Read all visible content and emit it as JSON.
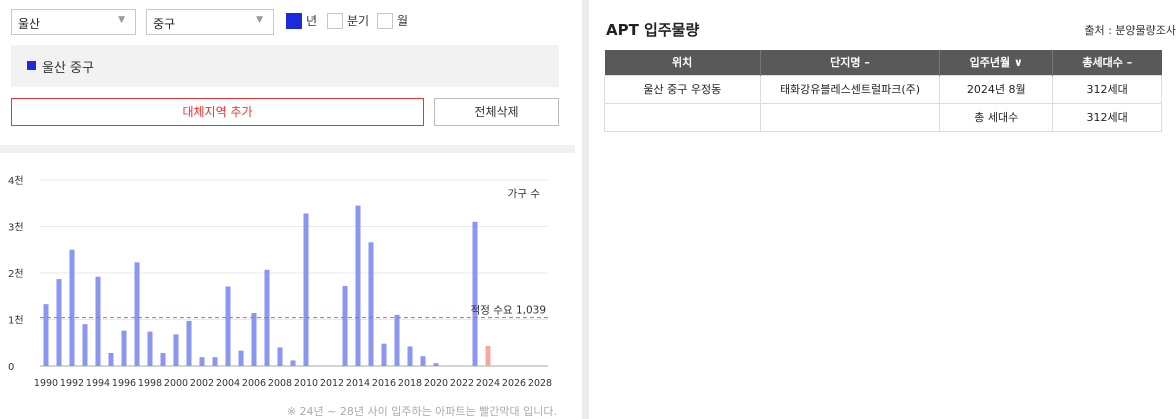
{
  "filters": {
    "region1": "울산",
    "region2": "중구",
    "period_options": [
      {
        "label": "년",
        "checked": true
      },
      {
        "label": "분기",
        "checked": false
      },
      {
        "label": "월",
        "checked": false
      }
    ]
  },
  "selected_region": "울산 중구",
  "buttons": {
    "add": "대체지역 추가",
    "delete_all": "전체삭제"
  },
  "footnote": "※ 24년 ~ 28년 사이 입주하는 아파트는 빨간막대 입니다.",
  "colors": {
    "accent": "#1a2bd8",
    "bar": "#8a96f0",
    "future_bar": "#f5a8a0",
    "ref_line": "#e55"
  },
  "chart_data": {
    "type": "bar",
    "legend": "가구 수",
    "y_ticks": [
      "0",
      "1천",
      "2천",
      "3천",
      "4천"
    ],
    "ylim": [
      0,
      4000
    ],
    "x_ticks": [
      "1990",
      "1992",
      "1994",
      "1996",
      "1998",
      "2000",
      "2002",
      "2004",
      "2006",
      "2008",
      "2010",
      "2012",
      "2014",
      "2016",
      "2018",
      "2020",
      "2022",
      "2024",
      "2026",
      "2028"
    ],
    "reference": {
      "label": "적정 수요 1,039",
      "value": 1039
    },
    "bars": [
      {
        "year": 1990,
        "value": 1330
      },
      {
        "year": 1991,
        "value": 1870
      },
      {
        "year": 1992,
        "value": 2500
      },
      {
        "year": 1993,
        "value": 900
      },
      {
        "year": 1994,
        "value": 1920
      },
      {
        "year": 1995,
        "value": 280
      },
      {
        "year": 1996,
        "value": 760
      },
      {
        "year": 1997,
        "value": 2230
      },
      {
        "year": 1998,
        "value": 740
      },
      {
        "year": 1999,
        "value": 280
      },
      {
        "year": 2000,
        "value": 680
      },
      {
        "year": 2001,
        "value": 970
      },
      {
        "year": 2002,
        "value": 190
      },
      {
        "year": 2003,
        "value": 190
      },
      {
        "year": 2004,
        "value": 1710
      },
      {
        "year": 2005,
        "value": 330
      },
      {
        "year": 2006,
        "value": 1140
      },
      {
        "year": 2007,
        "value": 2070
      },
      {
        "year": 2008,
        "value": 400
      },
      {
        "year": 2009,
        "value": 120
      },
      {
        "year": 2010,
        "value": 3280
      },
      {
        "year": 2013,
        "value": 1720
      },
      {
        "year": 2014,
        "value": 3450
      },
      {
        "year": 2015,
        "value": 2660
      },
      {
        "year": 2016,
        "value": 480
      },
      {
        "year": 2017,
        "value": 1100
      },
      {
        "year": 2018,
        "value": 420
      },
      {
        "year": 2019,
        "value": 210
      },
      {
        "year": 2020,
        "value": 60
      },
      {
        "year": 2023,
        "value": 3100
      },
      {
        "year": 2024,
        "value": 430,
        "future": true
      }
    ]
  },
  "apt": {
    "title": "APT 입주물량",
    "source": "출처 : 분양물량조사",
    "headers": [
      "위치",
      "단지명 –",
      "입주년월 ∨",
      "총세대수 –"
    ],
    "rows": [
      [
        "울산 중구 우정동",
        "태화강유블레스센트럴파크(주)",
        "2024년 8월",
        "312세대"
      ],
      [
        "",
        "",
        "총 세대수",
        "312세대"
      ]
    ]
  }
}
